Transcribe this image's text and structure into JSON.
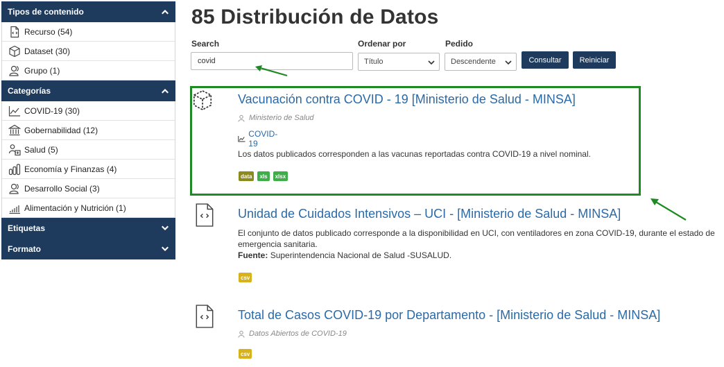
{
  "sidebar": {
    "content_types": {
      "title": "Tipos de contenido",
      "items": [
        {
          "label": "Recurso (54)",
          "icon": "file-code-icon"
        },
        {
          "label": "Dataset (30)",
          "icon": "cube-icon"
        },
        {
          "label": "Grupo (1)",
          "icon": "user-group-icon"
        }
      ]
    },
    "categories": {
      "title": "Categorías",
      "items": [
        {
          "label": "COVID-19 (30)",
          "icon": "line-chart-icon"
        },
        {
          "label": "Gobernabilidad (12)",
          "icon": "building-icon"
        },
        {
          "label": "Salud (5)",
          "icon": "health-icon"
        },
        {
          "label": "Economía y Finanzas (4)",
          "icon": "coins-icon"
        },
        {
          "label": "Desarrollo Social (3)",
          "icon": "people-icon"
        },
        {
          "label": "Alimentación y Nutrición (1)",
          "icon": "bar-chart-icon"
        }
      ]
    },
    "tags_title": "Etiquetas",
    "format_title": "Formato"
  },
  "main": {
    "heading": "85 Distribución de Datos",
    "search": {
      "label": "Search",
      "value": "covid"
    },
    "order_by": {
      "label": "Ordenar por",
      "selected": "Título"
    },
    "order": {
      "label": "Pedido",
      "selected": "Descendente"
    },
    "consult_button": "Consultar",
    "reset_button": "Reiniciar"
  },
  "results": [
    {
      "title": "Vacunación contra COVID - 19 [Ministerio de Salud - MINSA]",
      "publisher": "Ministerio de Salud",
      "category": "COVID-19",
      "description": "Los datos publicados corresponden a las vacunas reportadas contra COVID-19 a nivel nominal.",
      "formats": [
        "data",
        "xls",
        "xlsx"
      ]
    },
    {
      "title": "Unidad de Cuidados Intensivos – UCI - [Ministerio de Salud - MINSA]",
      "description_line1": "El conjunto de datos publicado corresponde a la disponibilidad en UCI, con ventiladores en zona COVID-19, durante el estado de",
      "description_line2": "emergencia sanitaria.",
      "source_label": "Fuente:",
      "source_value": "Superintendencia Nacional de Salud -SUSALUD.",
      "formats": [
        "csv"
      ]
    },
    {
      "title": "Total de Casos COVID-19 por Departamento - [Ministerio de Salud - MINSA]",
      "publisher": "Datos Abiertos de COVID-19",
      "formats": [
        "csv"
      ]
    }
  ],
  "colors": {
    "navy": "#1e3a5c",
    "link": "#2a6aa8",
    "highlight": "#1e8a24",
    "tag_data": "#8a8a1e",
    "tag_xls": "#3fae4a",
    "tag_csv": "#d8b21a"
  }
}
